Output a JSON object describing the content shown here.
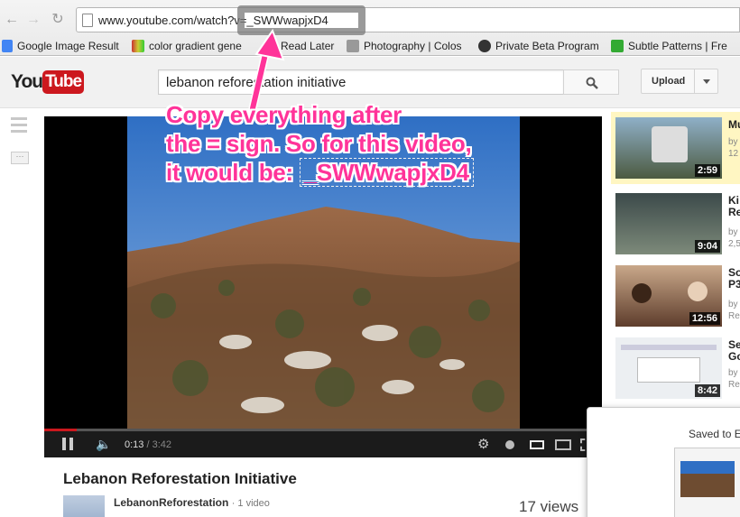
{
  "browser": {
    "url_prefix": "www.youtube.com/watch?v",
    "url_suffix": "=_SWWwapjxD4",
    "bookmarks": [
      {
        "label": "Google Image Result",
        "icon": "google-favicon",
        "color": "#4285f4"
      },
      {
        "label": "color gradient gene",
        "icon": "color-bars-favicon",
        "color": "#c93"
      },
      {
        "label": "Read Later",
        "icon": "read-later-favicon",
        "color": "#aaa"
      },
      {
        "label": "Photography | Colos",
        "icon": "photo-favicon",
        "color": "#888"
      },
      {
        "label": "Private Beta Program",
        "icon": "github-favicon",
        "color": "#333"
      },
      {
        "label": "Subtle Patterns | Fre",
        "icon": "subtle-patterns-favicon",
        "color": "#3a3"
      }
    ]
  },
  "youtube": {
    "logo_you": "You",
    "logo_tube": "Tube",
    "search_value": "lebanon reforestation initiative",
    "upload_label": "Upload",
    "brand_color": "#cc181e"
  },
  "player": {
    "current_time": "0:13",
    "duration": "/ 3:42",
    "progress": 0.058
  },
  "video": {
    "title": "Lebanon Reforestation Initiative",
    "channel": "LebanonReforestation",
    "video_count": "· 1 video",
    "views": "17 views"
  },
  "sidebar": [
    {
      "title_l1": "Mu",
      "title_l2": "",
      "by": "by",
      "meta": "12",
      "duration": "2:59"
    },
    {
      "title_l1": "Ki",
      "title_l2": "Re",
      "by": "by",
      "meta": "2,5",
      "duration": "9:04"
    },
    {
      "title_l1": "So",
      "title_l2": "P3",
      "by": "by",
      "meta": "Re",
      "duration": "12:56"
    },
    {
      "title_l1": "Se",
      "title_l2": "Go",
      "by": "by",
      "meta": "Re",
      "duration": "8:42"
    }
  ],
  "saved_panel": {
    "text": "Saved to E"
  },
  "annotation": {
    "line1": "Copy everything after",
    "line2": "the = sign. So for this video,",
    "line3": "it would be: ",
    "code": "_SWWwapjxD4",
    "color": "#ff3399"
  }
}
